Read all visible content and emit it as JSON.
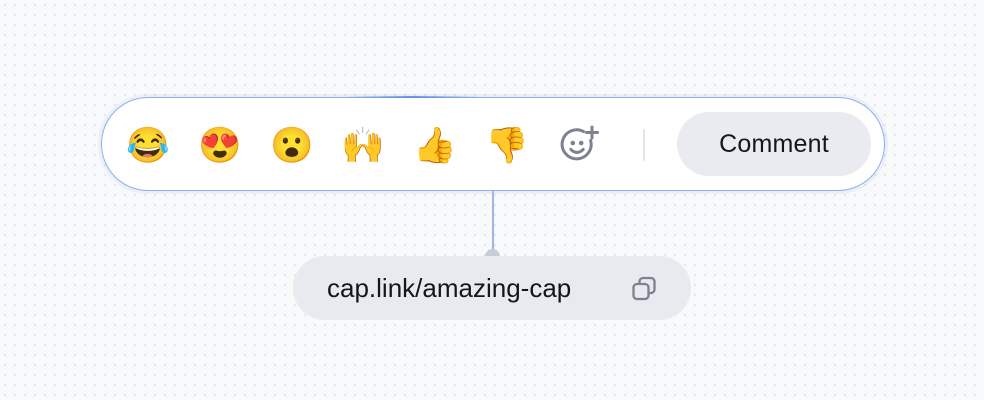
{
  "reactions": [
    {
      "emoji": "😂",
      "icon": "tears-of-joy-emoji-icon"
    },
    {
      "emoji": "😍",
      "icon": "heart-eyes-emoji-icon"
    },
    {
      "emoji": "😮",
      "icon": "open-mouth-emoji-icon"
    },
    {
      "emoji": "🙌",
      "icon": "raising-hands-emoji-icon"
    },
    {
      "emoji": "👍",
      "icon": "thumbs-up-emoji-icon"
    },
    {
      "emoji": "👎",
      "icon": "thumbs-down-emoji-icon"
    }
  ],
  "toolbar": {
    "add_reaction_icon": "add-reaction-icon",
    "comment_label": "Comment"
  },
  "share": {
    "link_text": "cap.link/amazing-cap",
    "copy_icon": "copy-icon"
  },
  "colors": {
    "toolbar_border": "#8fb1ea",
    "connector": "#9db7e6",
    "pill_background": "#e9ebf0",
    "icon_gray": "#7d8290",
    "text": "#14161c"
  }
}
